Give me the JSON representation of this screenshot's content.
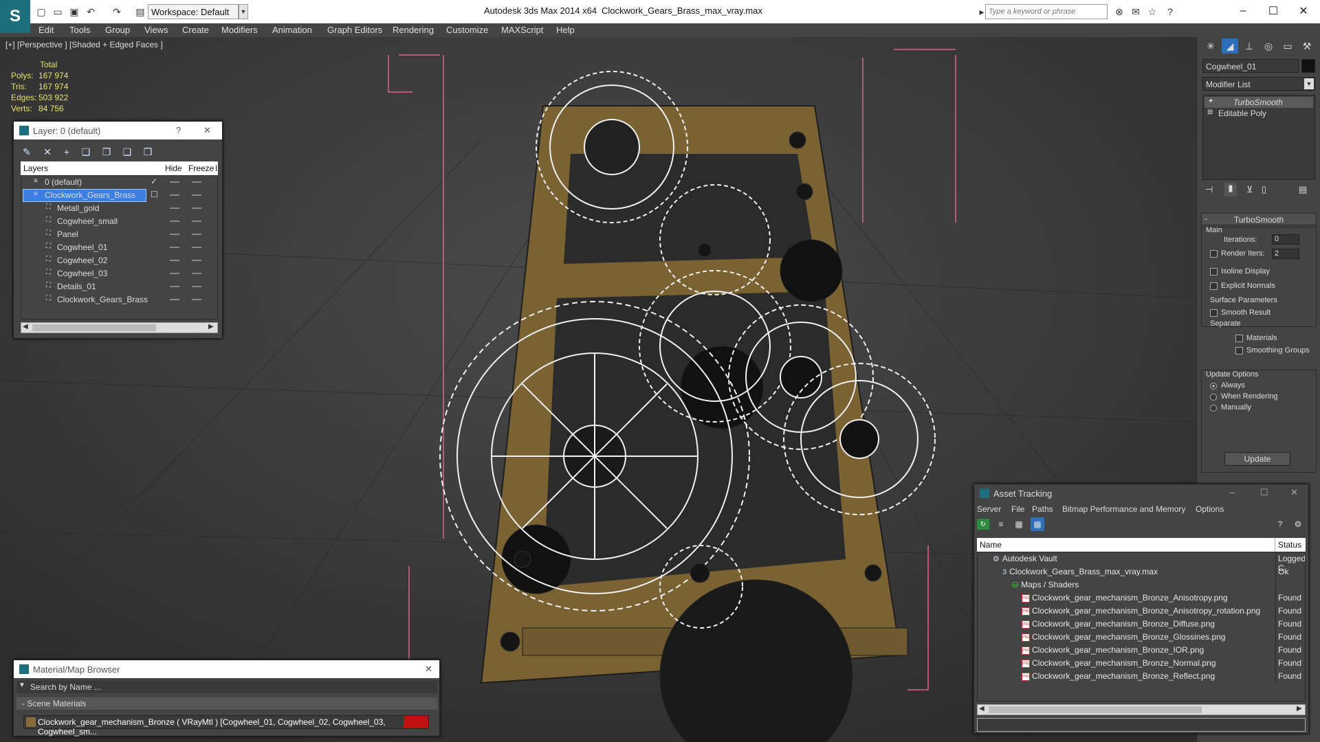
{
  "titlebar": {
    "workspace": "Workspace: Default",
    "app": "Autodesk 3ds Max  2014 x64",
    "file": "Clockwork_Gears_Brass_max_vray.max",
    "search_placeholder": "Type a keyword or phrase"
  },
  "menu": [
    "Edit",
    "Tools",
    "Group",
    "Views",
    "Create",
    "Modifiers",
    "Animation",
    "Graph Editors",
    "Rendering",
    "Customize",
    "MAXScript",
    "Help"
  ],
  "viewport": {
    "label": "[+] [Perspective ] [Shaded + Edged Faces ]",
    "stats": {
      "header": "Total",
      "rows": [
        {
          "label": "Polys:",
          "value": "167 974"
        },
        {
          "label": "Tris:",
          "value": "167 974"
        },
        {
          "label": "Edges:",
          "value": "503 922"
        },
        {
          "label": "Verts:",
          "value": "84 756"
        }
      ]
    }
  },
  "layer_panel": {
    "title": "Layer: 0 (default)",
    "help": "?",
    "close": "✕",
    "columns": {
      "layers": "Layers",
      "hide": "Hide",
      "freeze": "Freeze",
      "extra": "I"
    },
    "rows": [
      {
        "name": "0 (default)",
        "indent": 0,
        "check": "✓",
        "selected": false
      },
      {
        "name": "Clockwork_Gears_Brass",
        "indent": 0,
        "check": "",
        "selected": true
      },
      {
        "name": "Metall_gold",
        "indent": 1,
        "check": "",
        "selected": false
      },
      {
        "name": "Cogwheel_small",
        "indent": 1,
        "check": "",
        "selected": false
      },
      {
        "name": "Panel",
        "indent": 1,
        "check": "",
        "selected": false
      },
      {
        "name": "Cogwheel_01",
        "indent": 1,
        "check": "",
        "selected": false
      },
      {
        "name": "Cogwheel_02",
        "indent": 1,
        "check": "",
        "selected": false
      },
      {
        "name": "Cogwheel_03",
        "indent": 1,
        "check": "",
        "selected": false
      },
      {
        "name": "Details_01",
        "indent": 1,
        "check": "",
        "selected": false
      },
      {
        "name": "Clockwork_Gears_Brass",
        "indent": 1,
        "check": "",
        "selected": false
      }
    ]
  },
  "command_panel": {
    "object_name": "Cogwheel_01",
    "modifier_list": "Modifier List",
    "stack": [
      "TurboSmooth",
      "Editable Poly"
    ],
    "turbosmooth": {
      "title": "TurboSmooth",
      "main": "Main",
      "iterations_label": "Iterations:",
      "iterations": "0",
      "render_iters_label": "Render Iters:",
      "render_iters": "2",
      "isoline": "Isoline Display",
      "explicit": "Explicit Normals",
      "surface": "Surface Parameters",
      "smooth_result": "Smooth Result",
      "separate": "Separate",
      "materials": "Materials",
      "smoothing_groups": "Smoothing Groups",
      "update_options": "Update Options",
      "always": "Always",
      "when_rendering": "When Rendering",
      "manually": "Manually",
      "update": "Update"
    }
  },
  "asset_panel": {
    "title": "Asset Tracking",
    "menu": [
      "Server",
      "File",
      "Paths",
      "Bitmap Performance and Memory",
      "Options"
    ],
    "columns": {
      "name": "Name",
      "status": "Status"
    },
    "rows": [
      {
        "name": "Autodesk Vault",
        "status": "Logged C",
        "indent": 0,
        "icon": "vault"
      },
      {
        "name": "Clockwork_Gears_Brass_max_vray.max",
        "status": "Ok",
        "indent": 1,
        "icon": "max"
      },
      {
        "name": "Maps / Shaders",
        "status": "",
        "indent": 2,
        "icon": "folder"
      },
      {
        "name": "Clockwork_gear_mechanism_Bronze_Anisotropy.png",
        "status": "Found",
        "indent": 3,
        "icon": "png"
      },
      {
        "name": "Clockwork_gear_mechanism_Bronze_Anisotropy_rotation.png",
        "status": "Found",
        "indent": 3,
        "icon": "png"
      },
      {
        "name": "Clockwork_gear_mechanism_Bronze_Diffuse.png",
        "status": "Found",
        "indent": 3,
        "icon": "png"
      },
      {
        "name": "Clockwork_gear_mechanism_Bronze_Glossines.png",
        "status": "Found",
        "indent": 3,
        "icon": "png"
      },
      {
        "name": "Clockwork_gear_mechanism_Bronze_IOR.png",
        "status": "Found",
        "indent": 3,
        "icon": "png"
      },
      {
        "name": "Clockwork_gear_mechanism_Bronze_Normal.png",
        "status": "Found",
        "indent": 3,
        "icon": "png"
      },
      {
        "name": "Clockwork_gear_mechanism_Bronze_Reflect.png",
        "status": "Found",
        "indent": 3,
        "icon": "png"
      }
    ]
  },
  "material_panel": {
    "title": "Material/Map Browser",
    "search": "Search by Name ...",
    "section": "- Scene Materials",
    "item": "Clockwork_gear_mechanism_Bronze  ( VRayMtl ) [Cogwheel_01, Cogwheel_02, Cogwheel_03, Cogwheel_sm..."
  }
}
